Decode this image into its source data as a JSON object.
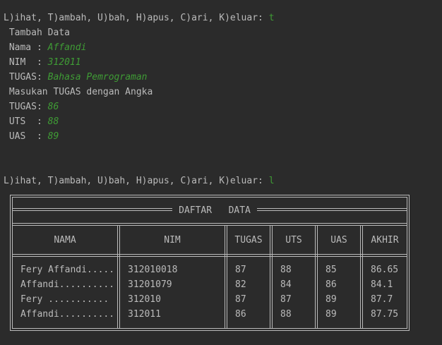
{
  "console": {
    "prompt1": "L)ihat, T)ambah, U)bah, H)apus, C)ari, K)eluar: ",
    "input1": "t",
    "tambah_title": " Tambah Data",
    "nama_label": " Nama : ",
    "nama_value": "Affandi",
    "nim_label": " NIM  : ",
    "nim_value": "312011",
    "tugas_label": " TUGAS: ",
    "tugas_value": "Bahasa Pemrograman",
    "masukan": " Masukan TUGAS dengan Angka",
    "tugas2_label": " TUGAS: ",
    "tugas2_value": "86",
    "uts_label": " UTS  : ",
    "uts_value": "88",
    "uas_label": " UAS  : ",
    "uas_value": "89",
    "prompt2": "L)ihat, T)ambah, U)bah, H)apus, C)ari, K)eluar: ",
    "input2": "l"
  },
  "table": {
    "title": "DAFTAR   DATA",
    "headers": [
      "NAMA",
      "NIM",
      "TUGAS",
      "UTS",
      "UAS",
      "AKHIR"
    ],
    "rows": [
      [
        "Fery Affandi.....",
        "312010018",
        "87",
        "88",
        "85",
        "86.65"
      ],
      [
        "Affandi..........",
        "31201079",
        "82",
        "84",
        "86",
        "84.1"
      ],
      [
        "Fery ...........",
        "312010",
        "87",
        "87",
        "89",
        "87.7"
      ],
      [
        "Affandi..........",
        "312011",
        "86",
        "88",
        "89",
        "87.75"
      ]
    ]
  },
  "colors": {
    "background": "#2b2b2b",
    "text": "#bbbbbb",
    "input": "#3f9c35"
  }
}
